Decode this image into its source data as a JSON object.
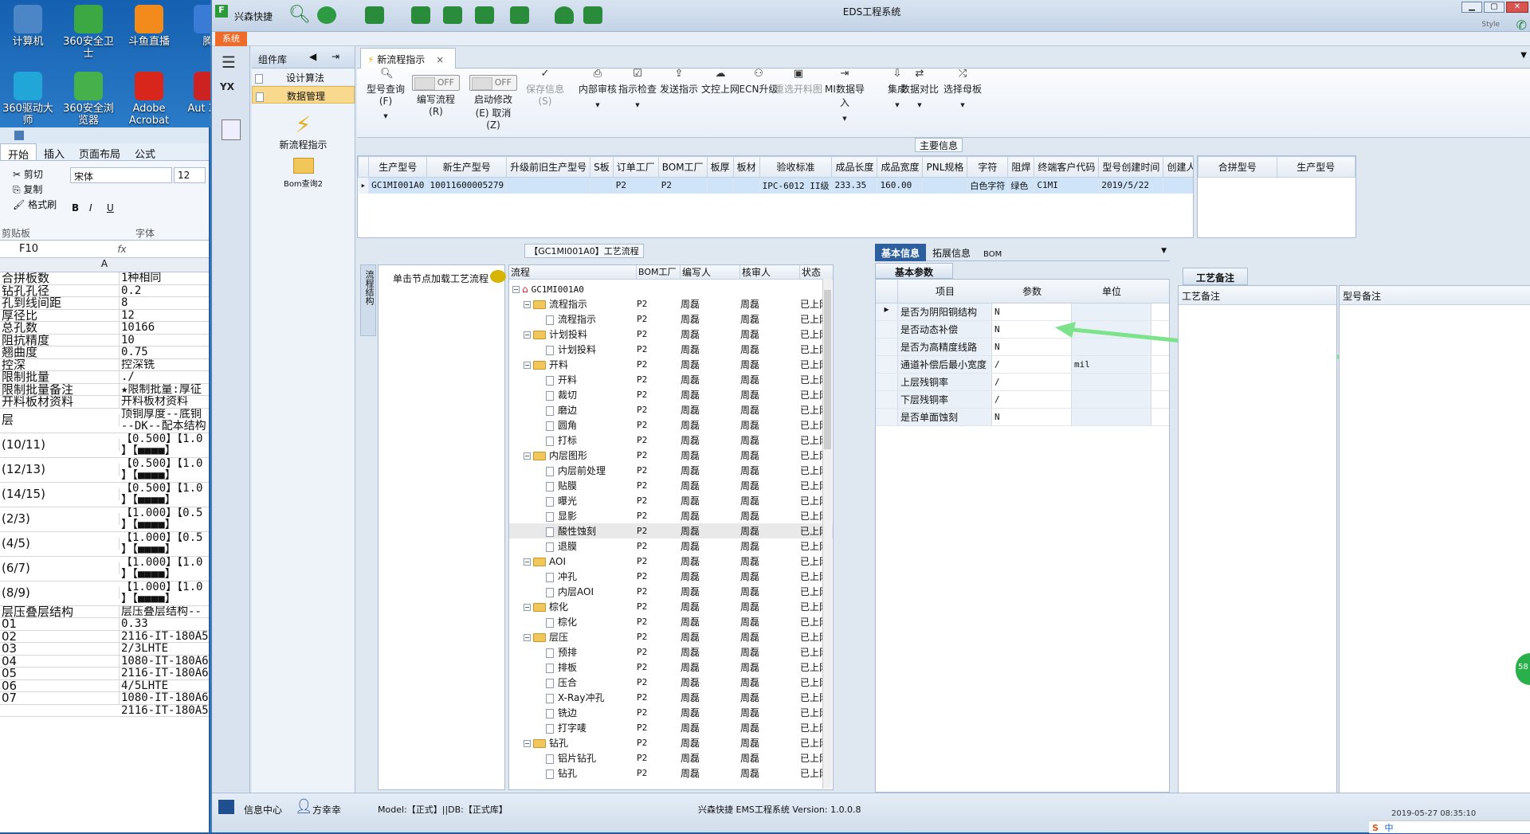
{
  "desktop": {
    "icons": [
      {
        "label": "计算机",
        "color": "#4d86c7"
      },
      {
        "label": "360安全卫士",
        "color": "#3ca844"
      },
      {
        "label": "斗鱼直播",
        "color": "#f28a1c"
      },
      {
        "label": "腾",
        "color": "#3a7bd5"
      },
      {
        "label": "360驱动大师",
        "color": "#22a6d8"
      },
      {
        "label": "360安全浏览器",
        "color": "#46b04a"
      },
      {
        "label": "Adobe Acrobat",
        "color": "#d8261d"
      },
      {
        "label": "Aut 201",
        "color": "#c22"
      }
    ]
  },
  "excel": {
    "tabs": [
      "开始",
      "插入",
      "页面布局",
      "公式"
    ],
    "clipboard": {
      "cut": "剪切",
      "copy": "复制",
      "format": "格式刷",
      "group": "剪贴板"
    },
    "font": {
      "name": "宋体",
      "size": "12",
      "group": "字体"
    },
    "name_box": "F10",
    "fx": "fx",
    "col_header": "A",
    "rows": [
      {
        "a": "合拼板数",
        "b": "1种相同",
        "h": 16
      },
      {
        "a": "钻孔孔径",
        "b": "0.2",
        "h": 16
      },
      {
        "a": "孔到线间距",
        "b": "8",
        "h": 16
      },
      {
        "a": "厚径比",
        "b": "12",
        "h": 16
      },
      {
        "a": "总孔数",
        "b": "10166",
        "h": 16
      },
      {
        "a": "阻抗精度",
        "b": "10",
        "h": 16
      },
      {
        "a": "翘曲度",
        "b": "0.75",
        "h": 16
      },
      {
        "a": "控深",
        "b": "控深铣",
        "h": 16
      },
      {
        "a": "限制批量",
        "b": "./",
        "h": 16
      },
      {
        "a": "限制批量备注",
        "b": "★限制批量:厚征",
        "h": 16
      },
      {
        "a": "开料板材资料",
        "b": "开料板材资料",
        "h": 16
      },
      {
        "a": "层",
        "b": "顶铜厚度--底铜 --DK--配本结构",
        "h": 32
      },
      {
        "a": "(10/11)",
        "b": "【0.500】【1.0 】【■■■■】",
        "h": 32
      },
      {
        "a": "(12/13)",
        "b": "【0.500】【1.0 】【■■■■】",
        "h": 32
      },
      {
        "a": "(14/15)",
        "b": "【0.500】【1.0 】【■■■■】",
        "h": 32
      },
      {
        "a": "(2/3)",
        "b": "【1.000】【0.5 】【■■■■】",
        "h": 32
      },
      {
        "a": "(4/5)",
        "b": "【1.000】【0.5 】【■■■■】",
        "h": 32
      },
      {
        "a": "(6/7)",
        "b": "【1.000】【1.0 】【■■■■】",
        "h": 32
      },
      {
        "a": "(8/9)",
        "b": "【1.000】【1.0 】【■■■■】",
        "h": 32
      },
      {
        "a": "层压叠层结构",
        "b": "层压叠层结构--",
        "h": 16
      },
      {
        "a": "01",
        "b": "0.33",
        "h": 16
      },
      {
        "a": "02",
        "b": "2116-IT-180A5",
        "h": 16
      },
      {
        "a": "03",
        "b": "2/3LHTE",
        "h": 16
      },
      {
        "a": "04",
        "b": "1080-IT-180A6",
        "h": 16
      },
      {
        "a": "05",
        "b": "2116-IT-180A6",
        "h": 16
      },
      {
        "a": "06",
        "b": "4/5LHTE",
        "h": 16
      },
      {
        "a": "07",
        "b": "1080-IT-180A6",
        "h": 16
      },
      {
        "a": "",
        "b": "2116-IT-180A5",
        "h": 16
      }
    ]
  },
  "app": {
    "title": "EDS工程系统",
    "quick_label": "兴森快捷",
    "system_tab": "系统",
    "style_label": "Style",
    "sidebar_left": {
      "badge": "YX"
    },
    "component_panel": {
      "title": "组件库",
      "items": [
        "设计算法",
        "数据管理"
      ],
      "big_items": [
        "新流程指示",
        "Bom查询2"
      ]
    },
    "doc_tab": "新流程指示",
    "toolbar": [
      {
        "label": "型号查询(F)",
        "icon": "search-icon",
        "dd": true
      },
      {
        "label": "编写流程(R)",
        "icon": "toggle",
        "toggle": "OFF"
      },
      {
        "label": "启动修改(E) 取消(Z)",
        "icon": "toggle",
        "toggle": "OFF"
      },
      {
        "label": "保存信息(S)",
        "icon": "check-icon",
        "disabled": true
      },
      {
        "label": "内部审核",
        "icon": "print-icon",
        "dd": true
      },
      {
        "label": "指示检查",
        "icon": "checkbox-icon",
        "dd": true
      },
      {
        "label": "发送指示",
        "icon": "upload-icon"
      },
      {
        "label": "文控上网",
        "icon": "cloud-icon"
      },
      {
        "label": "ECN升级",
        "icon": "users-icon"
      },
      {
        "label": "重选开料图",
        "icon": "image-icon",
        "disabled": true
      },
      {
        "label": "MI数据导入",
        "icon": "import-icon",
        "dd": true
      },
      {
        "label": "集成",
        "icon": "download-icon",
        "dd": true
      },
      {
        "label": "数据对比",
        "icon": "compare-icon",
        "dd": true
      },
      {
        "label": "选择母板",
        "icon": "shuffle-icon",
        "dd": true
      }
    ],
    "main_info": {
      "caption": "主要信息",
      "columns": [
        "生产型号",
        "新生产型号",
        "升级前旧生产型号",
        "S板",
        "订单工厂",
        "BOM工厂",
        "板厚",
        "板材",
        "验收标准",
        "成品长度",
        "成品宽度",
        "PNL规格",
        "字符",
        "阻焊",
        "终端客户代码",
        "型号创建时间",
        "创建人"
      ],
      "row": [
        "GC1MI001A0",
        "10011600005279",
        "",
        "",
        "P2",
        "P2",
        "",
        "",
        "IPC-6012 II级",
        "233.35",
        "160.00",
        "",
        "白色字符",
        "绿色",
        "C1MI",
        "2019/5/22",
        ""
      ],
      "side_columns": [
        "合拼型号",
        "生产型号"
      ]
    },
    "flow": {
      "caption": "【GC1MI001A0】工艺流程",
      "vertical_tab": "流程结构",
      "hint": "单击节点加载工艺流程",
      "columns": [
        "流程",
        "BOM工厂",
        "编写人",
        "核审人",
        "状态"
      ],
      "root": "GC1MI001A0",
      "rows": [
        {
          "name": "流程指示",
          "lvl": 1,
          "folder": true
        },
        {
          "name": "流程指示",
          "lvl": 2
        },
        {
          "name": "计划投料",
          "lvl": 1,
          "folder": true
        },
        {
          "name": "计划投料",
          "lvl": 2
        },
        {
          "name": "开料",
          "lvl": 1,
          "folder": true
        },
        {
          "name": "开料",
          "lvl": 2
        },
        {
          "name": "裁切",
          "lvl": 2
        },
        {
          "name": "磨边",
          "lvl": 2
        },
        {
          "name": "圆角",
          "lvl": 2
        },
        {
          "name": "打标",
          "lvl": 2
        },
        {
          "name": "内层图形",
          "lvl": 1,
          "folder": true
        },
        {
          "name": "内层前处理",
          "lvl": 2
        },
        {
          "name": "贴膜",
          "lvl": 2
        },
        {
          "name": "曝光",
          "lvl": 2
        },
        {
          "name": "显影",
          "lvl": 2
        },
        {
          "name": "酸性蚀刻",
          "lvl": 2,
          "sel": true
        },
        {
          "name": "退膜",
          "lvl": 2
        },
        {
          "name": "AOI",
          "lvl": 1,
          "folder": true
        },
        {
          "name": "冲孔",
          "lvl": 2
        },
        {
          "name": "内层AOI",
          "lvl": 2
        },
        {
          "name": "棕化",
          "lvl": 1,
          "folder": true
        },
        {
          "name": "棕化",
          "lvl": 2
        },
        {
          "name": "层压",
          "lvl": 1,
          "folder": true
        },
        {
          "name": "预排",
          "lvl": 2
        },
        {
          "name": "排板",
          "lvl": 2
        },
        {
          "name": "压合",
          "lvl": 2
        },
        {
          "name": "X-Ray冲孔",
          "lvl": 2
        },
        {
          "name": "铣边",
          "lvl": 2
        },
        {
          "name": "打字唛",
          "lvl": 2
        },
        {
          "name": "钻孔",
          "lvl": 1,
          "folder": true
        },
        {
          "name": "铝片钻孔",
          "lvl": 2
        },
        {
          "name": "钻孔",
          "lvl": 2
        }
      ],
      "factory": "P2",
      "writer": "周磊",
      "reviewer": "周磊",
      "status": "已上网"
    },
    "basic": {
      "tabs": [
        "基本信息",
        "拓展信息",
        "BOM"
      ],
      "subtab": "基本参数",
      "columns": [
        "项目",
        "参数",
        "单位"
      ],
      "rows": [
        {
          "item": "是否为阴阳铜结构",
          "param": "N",
          "unit": ""
        },
        {
          "item": "是否动态补偿",
          "param": "N",
          "unit": ""
        },
        {
          "item": "是否为高精度线路",
          "param": "N",
          "unit": ""
        },
        {
          "item": "通道补偿后最小宽度",
          "param": "/",
          "unit": "mil"
        },
        {
          "item": "上层残铜率",
          "param": "/",
          "unit": ""
        },
        {
          "item": "下层残铜率",
          "param": "/",
          "unit": ""
        },
        {
          "item": "是否单面蚀刻",
          "param": "N",
          "unit": ""
        }
      ],
      "arrow_color": "#7de38a"
    },
    "remarks": {
      "tab": "工艺备注",
      "col1": "工艺备注",
      "col2": "型号备注"
    },
    "statusbar": {
      "info": "信息中心",
      "user": "方幸幸",
      "model": "Model:【正式】||DB:【正式库】",
      "version": "兴森快捷 EMS工程系统 Version: 1.0.0.8",
      "clock": "2019-05-27 08:35:10"
    },
    "tray": {
      "lang": "中"
    }
  }
}
